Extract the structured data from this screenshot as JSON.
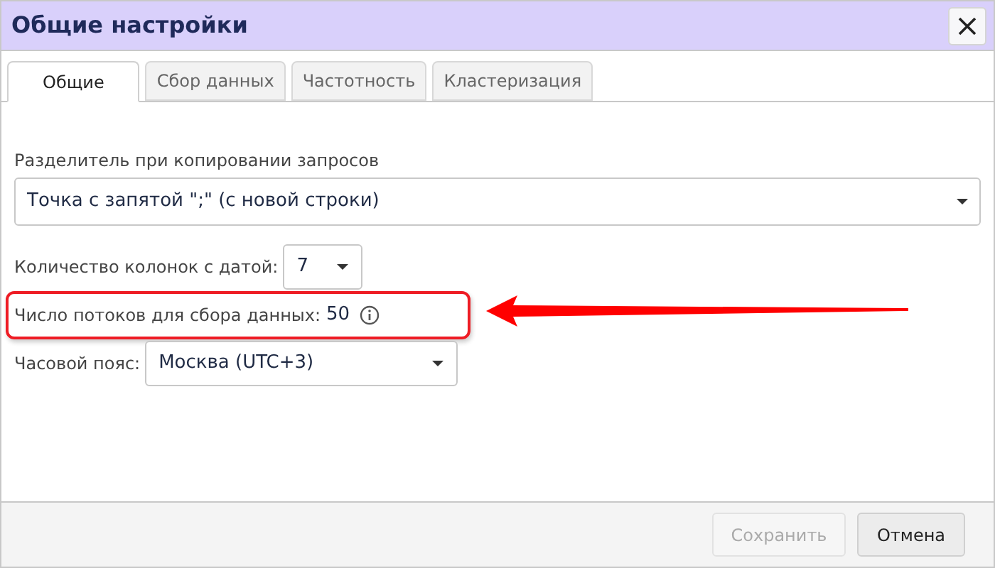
{
  "window": {
    "title": "Общие настройки"
  },
  "tabs": [
    {
      "label": "Общие",
      "selected": true
    },
    {
      "label": "Сбор данных",
      "selected": false
    },
    {
      "label": "Частотность",
      "selected": false
    },
    {
      "label": "Кластеризация",
      "selected": false
    }
  ],
  "fields": [
    {
      "kind": "block-select",
      "label": "Разделитель при копировании запросов",
      "value": "Точка с запятой \";\" (с новой строки)",
      "highlighted": false
    },
    {
      "kind": "inline-select",
      "label": "Количество колонок с датой:",
      "value": "7",
      "highlighted": false
    },
    {
      "kind": "info",
      "label": "Число потоков для сбора данных:",
      "value": "50",
      "highlighted": true
    },
    {
      "kind": "inline-select",
      "label": "Часовой пояс:",
      "value": "Москва (UTC+3)",
      "highlighted": false
    }
  ],
  "buttons": [
    {
      "label": "Сохранить",
      "disabled": true
    },
    {
      "label": "Отмена",
      "disabled": false
    }
  ]
}
